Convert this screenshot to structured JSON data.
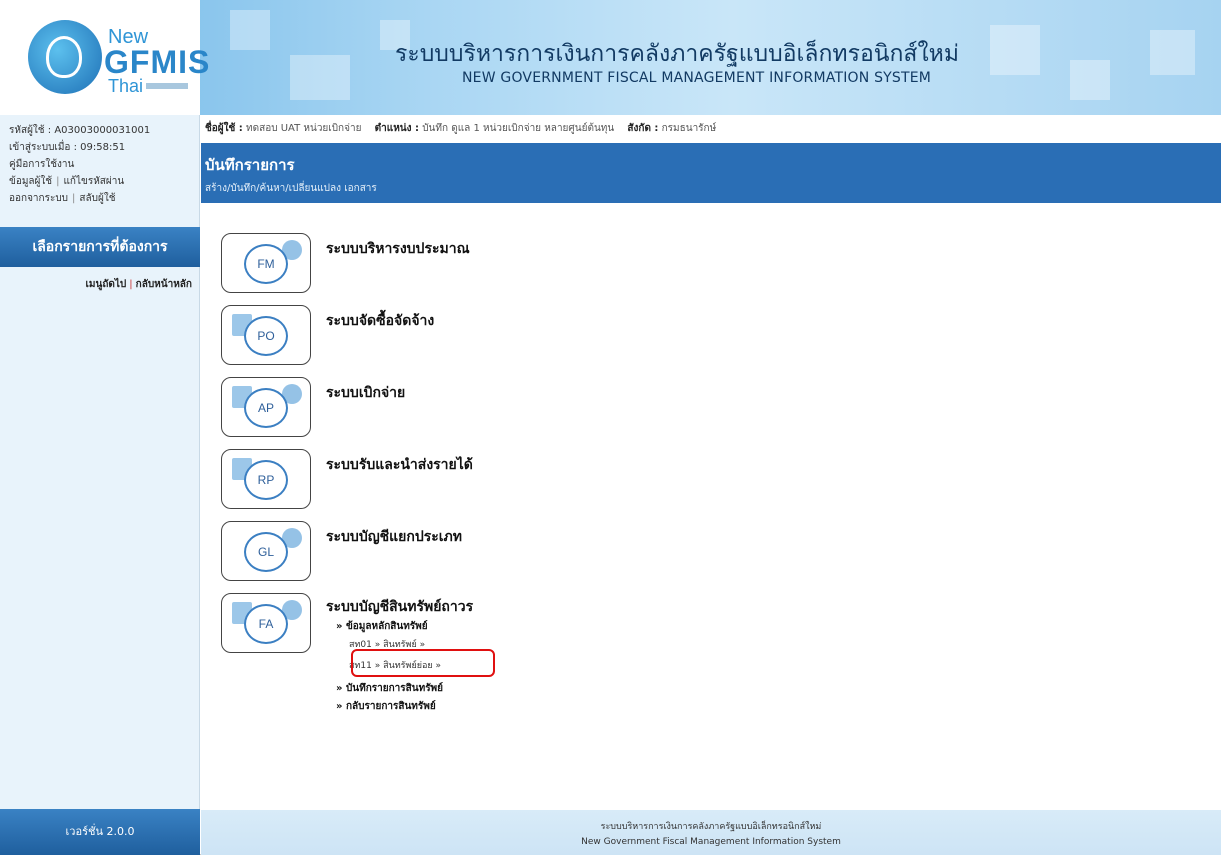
{
  "header": {
    "logo": {
      "new": "New",
      "brand": "GFMIS",
      "thai": "Thai"
    },
    "title_th": "ระบบบริหารการเงินการคลังภาครัฐแบบอิเล็กทรอนิกส์ใหม่",
    "title_en": "NEW GOVERNMENT FISCAL MANAGEMENT INFORMATION SYSTEM"
  },
  "sidebar": {
    "user_code_label": "รหัสผู้ใช้ :",
    "user_code": "A03003000031001",
    "login_label": "เข้าสู่ระบบเมื่อ :",
    "login_time": "09:58:51",
    "manual": "คู่มือการใช้งาน",
    "user_info": "ข้อมูลผู้ใช้",
    "change_password": "แก้ไขรหัสผ่าน",
    "logout": "ออกจากระบบ",
    "switch_user": "สลับผู้ใช้",
    "menu_title": "เลือกรายการที่ต้องการ",
    "next_menu": "เมนูถัดไป",
    "back_home": "กลับหน้าหลัก",
    "version": "เวอร์ชั่น 2.0.0"
  },
  "userbar": {
    "name_label": "ชื่อผู้ใช้ :",
    "name_value": "ทดสอบ UAT หน่วยเบิกจ่าย",
    "position_label": "ตำแหน่ง :",
    "position_value": "บันทึก ดูแล 1 หน่วยเบิกจ่าย หลายศูนย์ต้นทุน",
    "affiliation_label": "สังกัด :",
    "affiliation_value": "กรมธนารักษ์"
  },
  "banner": {
    "title": "บันทึกรายการ",
    "subtitle": "สร้าง/บันทึก/ค้นหา/เปลี่ยนแปลง เอกสาร"
  },
  "modules": [
    {
      "code": "FM",
      "title": "ระบบบริหารงบประมาณ"
    },
    {
      "code": "PO",
      "title": "ระบบจัดซื้อจัดจ้าง"
    },
    {
      "code": "AP",
      "title": "ระบบเบิกจ่าย"
    },
    {
      "code": "RP",
      "title": "ระบบรับและนำส่งรายได้"
    },
    {
      "code": "GL",
      "title": "ระบบบัญชีแยกประเภท"
    },
    {
      "code": "FA",
      "title": "ระบบบัญชีสินทรัพย์ถาวร"
    }
  ],
  "fa_menu": {
    "master": "» ข้อมูลหลักสินทรัพย์",
    "item1": "สท01 » สินทรัพย์ »",
    "item2": "สท11 » สินทรัพย์ย่อย »",
    "record": "» บันทึกรายการสินทรัพย์",
    "reverse": "» กลับรายการสินทรัพย์"
  },
  "footer": {
    "line1": "ระบบบริหารการเงินการคลังภาครัฐแบบอิเล็กทรอนิกส์ใหม่",
    "line2": "New Government Fiscal Management Information System"
  },
  "colors": {
    "primary": "#2a6eb5",
    "sidebar_bg": "#e8f3fb",
    "highlight": "#e01010"
  }
}
